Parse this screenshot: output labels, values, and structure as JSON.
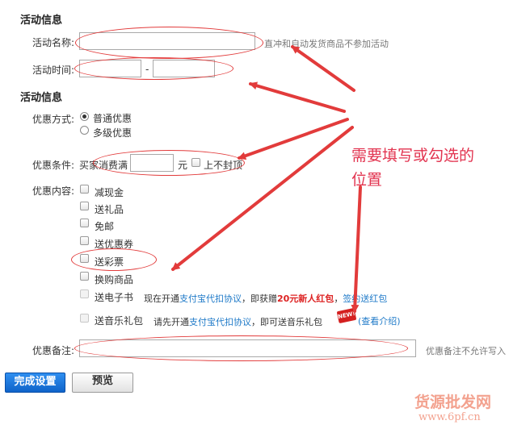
{
  "section1": {
    "title": "活动信息",
    "name_label": "活动名称:",
    "name_value": "",
    "name_hint": "直冲和自动发货商品不参加活动",
    "time_label": "活动时间:",
    "time_start": "",
    "time_sep": "-",
    "time_end": ""
  },
  "section2": {
    "title": "活动信息",
    "method_label": "优惠方式:",
    "method_options": [
      "普通优惠",
      "多级优惠"
    ],
    "method_selected": "普通优惠",
    "cond_label": "优惠条件:",
    "cond_prefix": "买家消费满",
    "cond_value": "",
    "cond_unit": "元",
    "cond_cap": "上不封顶",
    "content_label": "优惠内容:",
    "content_options": [
      "减现金",
      "送礼品",
      "免邮",
      "送优惠券",
      "送彩票",
      "换购商品",
      "送电子书",
      "送音乐礼包"
    ],
    "ebook_pre": "现在开通",
    "ebook_link1": "支付宝代扣协议",
    "ebook_mid": "，即获赠",
    "ebook_bonus": "20元新人红包",
    "ebook_sep": "，",
    "ebook_link2": "签约送红包",
    "music_pre": "请先开通",
    "music_link": "支付宝代扣协议",
    "music_mid": "，即可送音乐礼包",
    "music_badge": "NEW!",
    "music_view": "(查看介绍)",
    "remark_label": "优惠备注:",
    "remark_value": "",
    "remark_hint": "优惠备注不允许写入"
  },
  "buttons": {
    "submit": "完成设置",
    "preview": "预览"
  },
  "annotation": {
    "line1": "需要填写或勾选的",
    "line2": "位置"
  },
  "watermark": {
    "cn": "货源批发网",
    "url": "www.6pf.cn"
  },
  "colors": {
    "annotation_red": "#e23b3b",
    "link_blue": "#1f7ac8",
    "primary_button": "#1a73d6"
  }
}
